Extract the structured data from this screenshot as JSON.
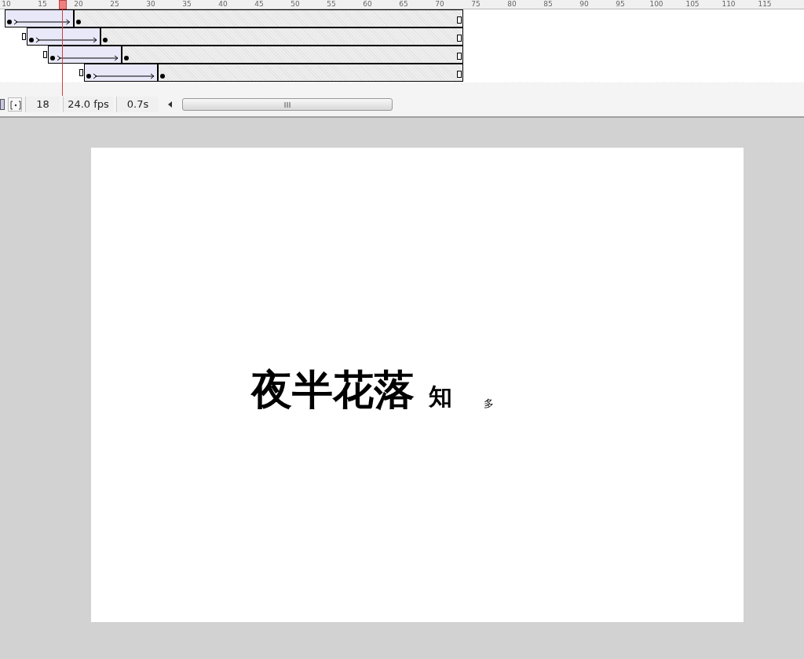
{
  "timeline": {
    "ruler_labels": [
      "10",
      "15",
      "20",
      "25",
      "30",
      "35",
      "40",
      "45",
      "50",
      "55",
      "60",
      "65",
      "70",
      "75",
      "80",
      "85",
      "90",
      "95",
      "100",
      "105",
      "110",
      "115"
    ],
    "layers": [
      {
        "kind": "motion_tween"
      },
      {
        "kind": "motion_tween"
      },
      {
        "kind": "motion_tween"
      },
      {
        "kind": "motion_tween"
      }
    ]
  },
  "status_bar": {
    "current_frame": "18",
    "frame_rate": "24.0 fps",
    "elapsed_time": "0.7s"
  },
  "stage": {
    "texts": [
      {
        "text": "夜半花落",
        "kind": "large"
      },
      {
        "text": "知",
        "kind": "medium"
      },
      {
        "text": "多",
        "kind": "small"
      }
    ]
  }
}
